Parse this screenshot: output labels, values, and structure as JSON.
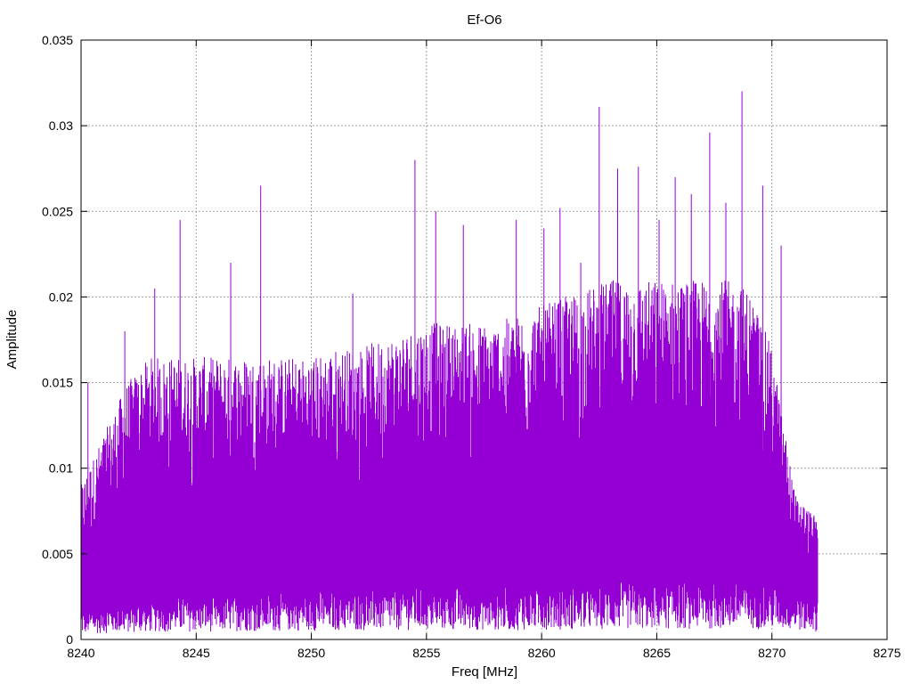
{
  "chart_data": {
    "type": "line",
    "title": "Ef-O6",
    "xlabel": "Freq [MHz]",
    "ylabel": "Amplitude",
    "xlim": [
      8240,
      8275
    ],
    "ylim": [
      0,
      0.035
    ],
    "x_ticks": [
      "8240",
      "8245",
      "8250",
      "8255",
      "8260",
      "8265",
      "8270",
      "8275"
    ],
    "y_ticks": [
      "0",
      "0.005",
      "0.01",
      "0.015",
      "0.02",
      "0.025",
      "0.03",
      "0.035"
    ],
    "grid": true,
    "legend": false,
    "series_color": "#9400D3",
    "series": [
      {
        "x_range": [
          8240,
          8272
        ],
        "envelope": [
          {
            "x": 8240.0,
            "low": 0.001,
            "high": 0.009
          },
          {
            "x": 8241.0,
            "low": 0.0012,
            "high": 0.012
          },
          {
            "x": 8242.0,
            "low": 0.0013,
            "high": 0.015
          },
          {
            "x": 8243.0,
            "low": 0.0014,
            "high": 0.0165
          },
          {
            "x": 8244.0,
            "low": 0.0015,
            "high": 0.0165
          },
          {
            "x": 8245.0,
            "low": 0.0015,
            "high": 0.0165
          },
          {
            "x": 8246.0,
            "low": 0.0015,
            "high": 0.0165
          },
          {
            "x": 8247.0,
            "low": 0.0016,
            "high": 0.0165
          },
          {
            "x": 8248.0,
            "low": 0.0016,
            "high": 0.0165
          },
          {
            "x": 8249.0,
            "low": 0.0016,
            "high": 0.0165
          },
          {
            "x": 8250.0,
            "low": 0.0017,
            "high": 0.0165
          },
          {
            "x": 8251.0,
            "low": 0.0017,
            "high": 0.017
          },
          {
            "x": 8252.0,
            "low": 0.0017,
            "high": 0.017
          },
          {
            "x": 8253.0,
            "low": 0.0017,
            "high": 0.0175
          },
          {
            "x": 8254.0,
            "low": 0.0018,
            "high": 0.018
          },
          {
            "x": 8255.0,
            "low": 0.0018,
            "high": 0.0185
          },
          {
            "x": 8256.0,
            "low": 0.0018,
            "high": 0.0185
          },
          {
            "x": 8257.0,
            "low": 0.0018,
            "high": 0.0185
          },
          {
            "x": 8258.0,
            "low": 0.0018,
            "high": 0.0185
          },
          {
            "x": 8259.0,
            "low": 0.0018,
            "high": 0.019
          },
          {
            "x": 8260.0,
            "low": 0.0019,
            "high": 0.0195
          },
          {
            "x": 8261.0,
            "low": 0.0019,
            "high": 0.02
          },
          {
            "x": 8262.0,
            "low": 0.0019,
            "high": 0.0205
          },
          {
            "x": 8263.0,
            "low": 0.002,
            "high": 0.021
          },
          {
            "x": 8264.0,
            "low": 0.002,
            "high": 0.021
          },
          {
            "x": 8265.0,
            "low": 0.002,
            "high": 0.021
          },
          {
            "x": 8266.0,
            "low": 0.002,
            "high": 0.021
          },
          {
            "x": 8267.0,
            "low": 0.002,
            "high": 0.021
          },
          {
            "x": 8268.0,
            "low": 0.002,
            "high": 0.021
          },
          {
            "x": 8269.0,
            "low": 0.002,
            "high": 0.0205
          },
          {
            "x": 8270.0,
            "low": 0.002,
            "high": 0.017
          },
          {
            "x": 8270.7,
            "low": 0.0018,
            "high": 0.011
          },
          {
            "x": 8271.0,
            "low": 0.0017,
            "high": 0.0085
          },
          {
            "x": 8272.0,
            "low": 0.0015,
            "high": 0.007
          }
        ],
        "peaks": [
          {
            "x": 8240.3,
            "y": 0.015
          },
          {
            "x": 8241.9,
            "y": 0.018
          },
          {
            "x": 8243.2,
            "y": 0.0205
          },
          {
            "x": 8244.3,
            "y": 0.0245
          },
          {
            "x": 8246.5,
            "y": 0.022
          },
          {
            "x": 8247.8,
            "y": 0.0265
          },
          {
            "x": 8251.8,
            "y": 0.0202
          },
          {
            "x": 8254.5,
            "y": 0.028
          },
          {
            "x": 8255.4,
            "y": 0.025
          },
          {
            "x": 8256.6,
            "y": 0.0242
          },
          {
            "x": 8258.9,
            "y": 0.0245
          },
          {
            "x": 8260.1,
            "y": 0.024
          },
          {
            "x": 8260.8,
            "y": 0.0252
          },
          {
            "x": 8261.7,
            "y": 0.022
          },
          {
            "x": 8262.5,
            "y": 0.0311
          },
          {
            "x": 8263.3,
            "y": 0.0275
          },
          {
            "x": 8264.2,
            "y": 0.0276
          },
          {
            "x": 8265.1,
            "y": 0.0245
          },
          {
            "x": 8265.8,
            "y": 0.027
          },
          {
            "x": 8266.5,
            "y": 0.026
          },
          {
            "x": 8267.3,
            "y": 0.0296
          },
          {
            "x": 8268.0,
            "y": 0.0255
          },
          {
            "x": 8268.7,
            "y": 0.032
          },
          {
            "x": 8269.6,
            "y": 0.0265
          },
          {
            "x": 8270.4,
            "y": 0.023
          }
        ]
      }
    ]
  }
}
